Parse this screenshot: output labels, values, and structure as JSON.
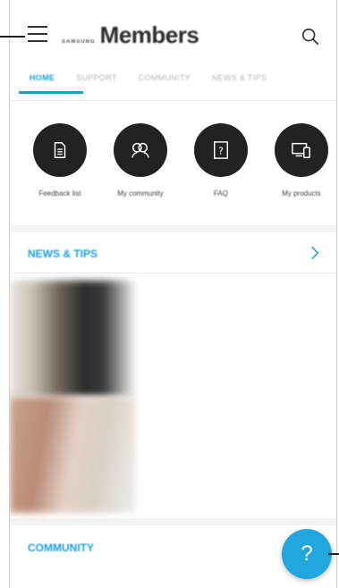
{
  "header": {
    "brand_small": "SAMSUNG",
    "brand_main": "Members"
  },
  "tabs": [
    {
      "label": "HOME",
      "active": true
    },
    {
      "label": "SUPPORT",
      "active": false
    },
    {
      "label": "COMMUNITY",
      "active": false
    },
    {
      "label": "NEWS & TIPS",
      "active": false
    }
  ],
  "quick_actions": [
    {
      "label": "Feedback list",
      "icon": "document-icon"
    },
    {
      "label": "My community",
      "icon": "people-icon"
    },
    {
      "label": "FAQ",
      "icon": "help-doc-icon"
    },
    {
      "label": "My products",
      "icon": "devices-icon"
    }
  ],
  "news": {
    "title": "NEWS & TIPS",
    "articles": [
      {
        "category": "",
        "title": "",
        "meta": ""
      },
      {
        "category": "",
        "title": "",
        "meta": ""
      }
    ]
  },
  "community": {
    "title": "COMMUNITY",
    "preview": ""
  },
  "fab": {
    "label": "?"
  },
  "colors": {
    "accent": "#1a9ed9",
    "fab": "#22a6e0",
    "icon_circle": "#222222"
  }
}
